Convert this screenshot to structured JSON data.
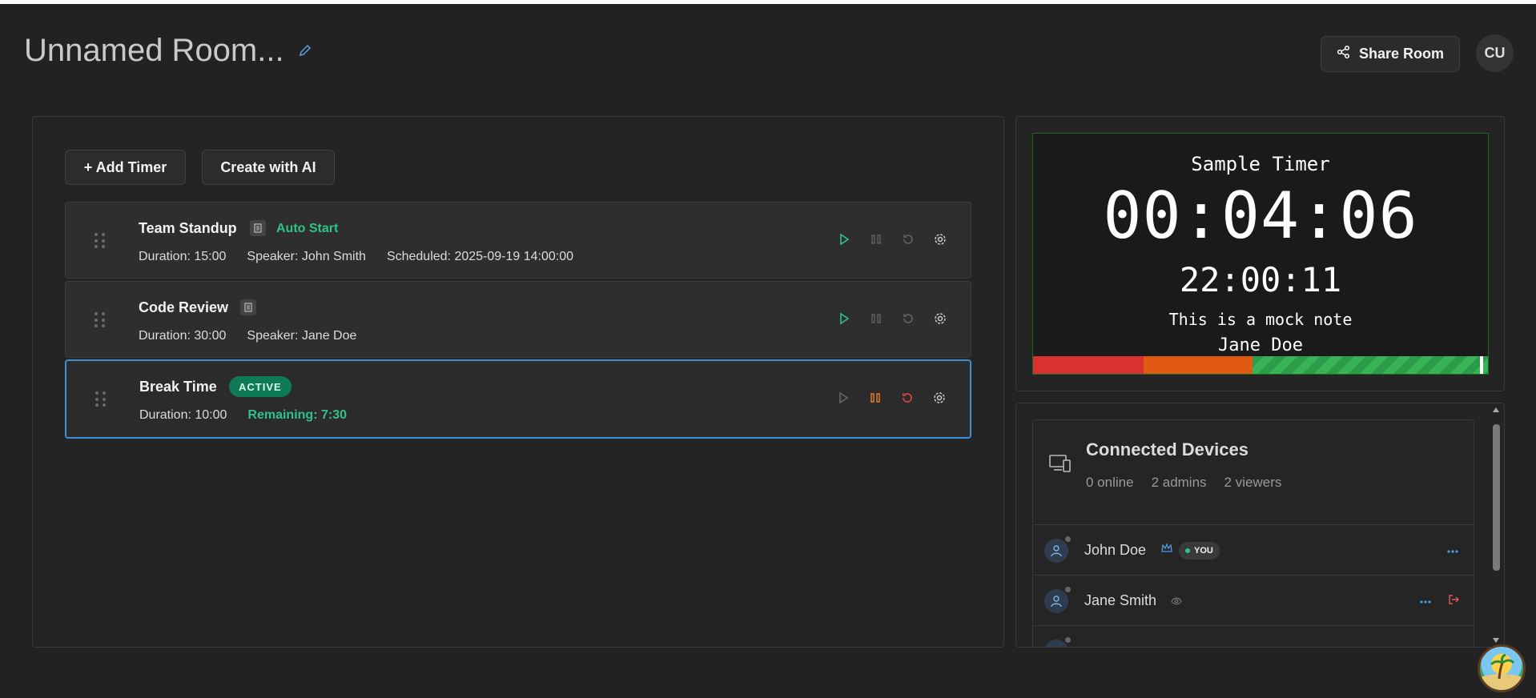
{
  "header": {
    "room_title": "Unnamed Room...",
    "share_label": "Share Room",
    "user_initials": "CU"
  },
  "toolbar": {
    "add_timer_label": "+ Add Timer",
    "create_ai_label": "Create with AI"
  },
  "timers": [
    {
      "name": "Team Standup",
      "tag": "Auto Start",
      "duration": "Duration: 15:00",
      "speaker": "Speaker: John Smith",
      "scheduled": "Scheduled: 2025-09-19 14:00:00"
    },
    {
      "name": "Code Review",
      "duration": "Duration: 30:00",
      "speaker": "Speaker: Jane Doe"
    },
    {
      "name": "Break Time",
      "badge": "ACTIVE",
      "duration": "Duration: 10:00",
      "remaining": "Remaining: 7:30"
    }
  ],
  "preview": {
    "title": "Sample Timer",
    "time": "00:04:06",
    "clock": "22:00:11",
    "note": "This is a mock note",
    "speaker": "Jane Doe"
  },
  "devices": {
    "title": "Connected Devices",
    "online": "0 online",
    "admins": "2 admins",
    "viewers": "2 viewers",
    "list": [
      {
        "name": "John Doe",
        "badge": "YOU"
      },
      {
        "name": "Jane Smith"
      }
    ]
  },
  "colors": {
    "accent_green": "#2fc28a",
    "active_border": "#3b8fd9",
    "pause_orange": "#e07a2a",
    "reset_red": "#e04848"
  }
}
